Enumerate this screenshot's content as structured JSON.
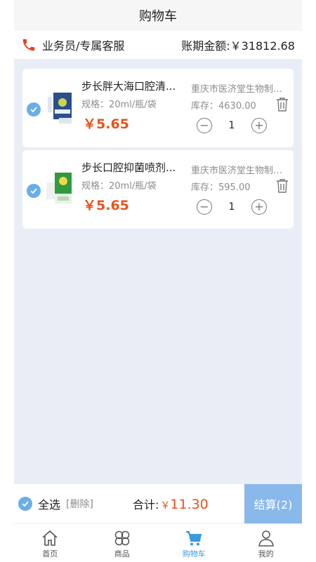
{
  "header": {
    "title": "购物车"
  },
  "info": {
    "service_label": "业务员/专属客服",
    "balance_label": "账期金额:￥31812.68"
  },
  "items": [
    {
      "title": "步长胖大海口腔清...",
      "spec": "规格：20ml/瓶/袋",
      "price": "￥5.65",
      "vendor": "重庆市医济堂生物制品...",
      "stock": "库存：4630.00",
      "qty": "1",
      "checked": true
    },
    {
      "title": "步长口腔抑菌喷剂...",
      "spec": "规格：20ml/瓶/袋",
      "price": "￥5.65",
      "vendor": "重庆市医济堂生物制品...",
      "stock": "库存：595.00",
      "qty": "1",
      "checked": true
    }
  ],
  "bottom": {
    "select_all": "全选",
    "delete": "[删除]",
    "total_label": "合计:",
    "currency": "￥",
    "total_amount": "11.30",
    "checkout_label": "结算(2)"
  },
  "tabs": [
    {
      "label": "首页",
      "icon": "home-icon"
    },
    {
      "label": "商品",
      "icon": "clover-icon"
    },
    {
      "label": "购物车",
      "icon": "cart-icon",
      "active": true
    },
    {
      "label": "我的",
      "icon": "person-icon"
    }
  ],
  "colors": {
    "accent": "#3a9bde",
    "price": "#e8541a",
    "checkout_bg": "#89b8ea",
    "background": "#e9eef6"
  }
}
